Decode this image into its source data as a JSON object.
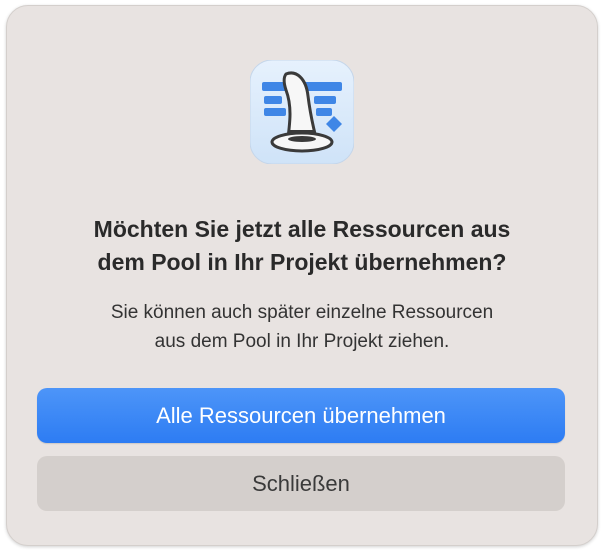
{
  "dialog": {
    "icon": "wizard-hat-app-icon",
    "title": "Möchten Sie jetzt alle Ressourcen aus\ndem Pool in Ihr Projekt übernehmen?",
    "message": "Sie können auch später einzelne Ressourcen\naus dem Pool in Ihr Projekt ziehen.",
    "primary_button": "Alle Ressourcen übernehmen",
    "secondary_button": "Schließen"
  },
  "colors": {
    "dialog_background": "#e8e3e1",
    "primary_button": "#3583f5",
    "secondary_button": "#d4cfcc",
    "icon_tile": "#dcebfb",
    "icon_bars": "#3f86e6"
  }
}
